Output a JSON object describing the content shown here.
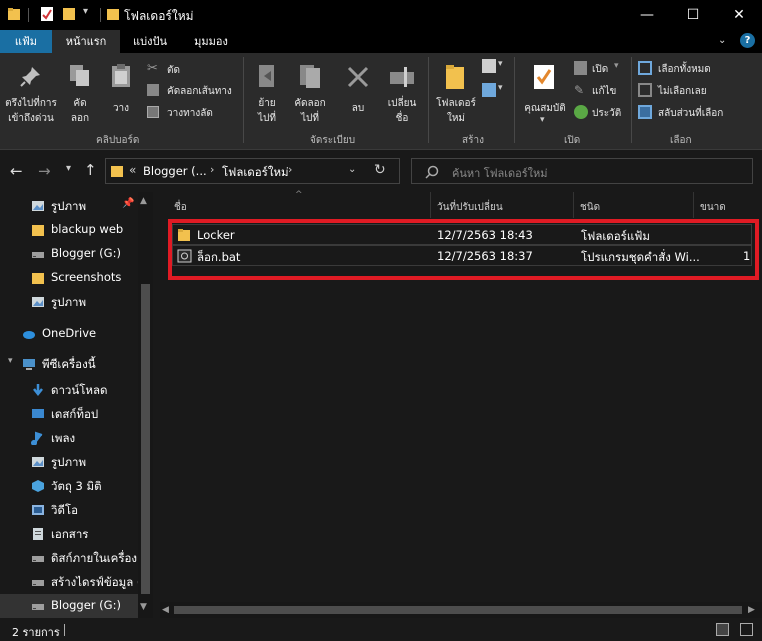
{
  "window": {
    "title": "โฟลเดอร์ใหม่",
    "minimize_glyph": "—",
    "maximize_glyph": "☐",
    "close_glyph": "✕"
  },
  "tabs": [
    {
      "label": "แฟ้ม"
    },
    {
      "label": "หน้าแรก"
    },
    {
      "label": "แบ่งปัน"
    },
    {
      "label": "มุมมอง"
    }
  ],
  "ribbon": {
    "clipboard": {
      "pin_label_1": "ตรึงไปที่การ",
      "pin_label_2": "เข้าถึงด่วน",
      "copy_label_1": "คัด",
      "copy_label_2": "ลอก",
      "paste_label": "วาง",
      "cut_label": "ตัด",
      "copy_path_label": "คัดลอกเส้นทาง",
      "paste_shortcut_label": "วางทางลัด",
      "group_name": "คลิปบอร์ด"
    },
    "organize": {
      "move_label_1": "ย้าย",
      "move_label_2": "ไปที่",
      "copyto_label_1": "คัดลอก",
      "copyto_label_2": "ไปที่",
      "delete_label": "ลบ",
      "rename_label_1": "เปลี่ยน",
      "rename_label_2": "ชื่อ",
      "group_name": "จัดระเบียบ"
    },
    "new": {
      "newfolder_label_1": "โฟลเดอร์",
      "newfolder_label_2": "ใหม่",
      "group_name": "สร้าง"
    },
    "open": {
      "properties_label": "คุณสมบัติ",
      "open_label": "เปิด",
      "edit_label": "แก้ไข",
      "history_label": "ประวัติ",
      "group_name": "เปิด"
    },
    "select": {
      "select_all_label": "เลือกทั้งหมด",
      "select_none_label": "ไม่เลือกเลย",
      "invert_label": "สลับส่วนที่เลือก",
      "group_name": "เลือก"
    }
  },
  "address": {
    "prefix": "«",
    "crumb_1": "Blogger (...",
    "crumb_2": "โฟลเดอร์ใหม่",
    "search_placeholder": "ค้นหา โฟลเดอร์ใหม่"
  },
  "nav": {
    "items": [
      {
        "label": "รูปภาพ",
        "icon": "pictures-icon"
      },
      {
        "label": "blackup web",
        "icon": "folder-icon"
      },
      {
        "label": "Blogger (G:)",
        "icon": "drive-icon"
      },
      {
        "label": "Screenshots",
        "icon": "folder-icon"
      },
      {
        "label": "รูปภาพ",
        "icon": "pictures-icon"
      },
      {
        "label": "OneDrive",
        "icon": "cloud-icon"
      },
      {
        "label": "พีซีเครื่องนี้",
        "icon": "computer-icon"
      },
      {
        "label": "ดาวน์โหลด",
        "icon": "download-icon"
      },
      {
        "label": "เดสก์ท็อป",
        "icon": "desktop-icon"
      },
      {
        "label": "เพลง",
        "icon": "music-icon"
      },
      {
        "label": "รูปภาพ",
        "icon": "pictures-icon"
      },
      {
        "label": "วัตถุ 3 มิติ",
        "icon": "3d-objects-icon"
      },
      {
        "label": "วิดีโอ",
        "icon": "video-icon"
      },
      {
        "label": "เอกสาร",
        "icon": "documents-icon"
      },
      {
        "label": "ดิสก์ภายในเครื่อง (C",
        "icon": "drive-icon"
      },
      {
        "label": "สร้างไดรฟ์ข้อมูล (D",
        "icon": "drive-icon"
      },
      {
        "label": "Blogger (G:)",
        "icon": "drive-icon"
      }
    ]
  },
  "files": {
    "columns": {
      "name": "ชื่อ",
      "modified": "วันที่ปรับเปลี่ยน",
      "type": "ชนิด",
      "size": "ขนาด"
    },
    "rows": [
      {
        "name": "Locker",
        "modified": "12/7/2563 18:43",
        "type": "โฟลเดอร์แฟ้ม",
        "size": "",
        "icon": "folder-icon"
      },
      {
        "name": "ล็อก.bat",
        "modified": "12/7/2563 18:37",
        "type": "โปรแกรมชุดคำสั่ง Wi...",
        "size": "1",
        "icon": "batch-file-icon"
      }
    ]
  },
  "status": {
    "count": "2 รายการ"
  },
  "colors": {
    "accent": "#1a6fa3",
    "highlight_box": "#e01b24",
    "folder": "#f2c14e"
  }
}
